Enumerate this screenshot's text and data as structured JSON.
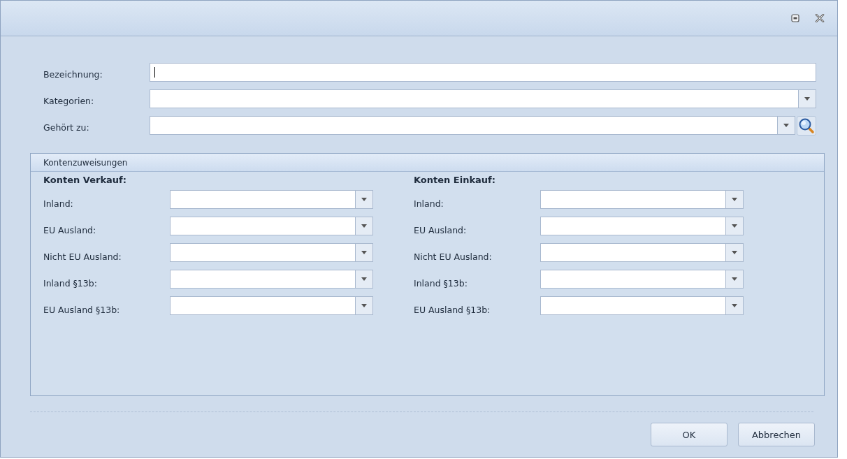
{
  "window": {
    "controls": [
      {
        "kind": "restore"
      },
      {
        "kind": "close"
      }
    ]
  },
  "fields": [
    {
      "label": "Bezeichnung:",
      "kind": "text",
      "focused": true
    },
    {
      "label": "Kategorien:",
      "kind": "combo"
    },
    {
      "label": "Gehört zu:",
      "kind": "combo-search"
    }
  ],
  "group": {
    "title": "Kontenzuweisungen",
    "columns": [
      {
        "heading": "Konten Verkauf:",
        "rows": [
          "Inland:",
          "EU Ausland:",
          "Nicht EU Ausland:",
          "Inland §13b:",
          "EU Ausland §13b:"
        ]
      },
      {
        "heading": "Konten Einkauf:",
        "rows": [
          "Inland:",
          "EU Ausland:",
          "Nicht EU Ausland:",
          "Inland §13b:",
          "EU Ausland §13b:"
        ]
      }
    ]
  },
  "buttons": [
    "OK",
    "Abbrechen"
  ]
}
